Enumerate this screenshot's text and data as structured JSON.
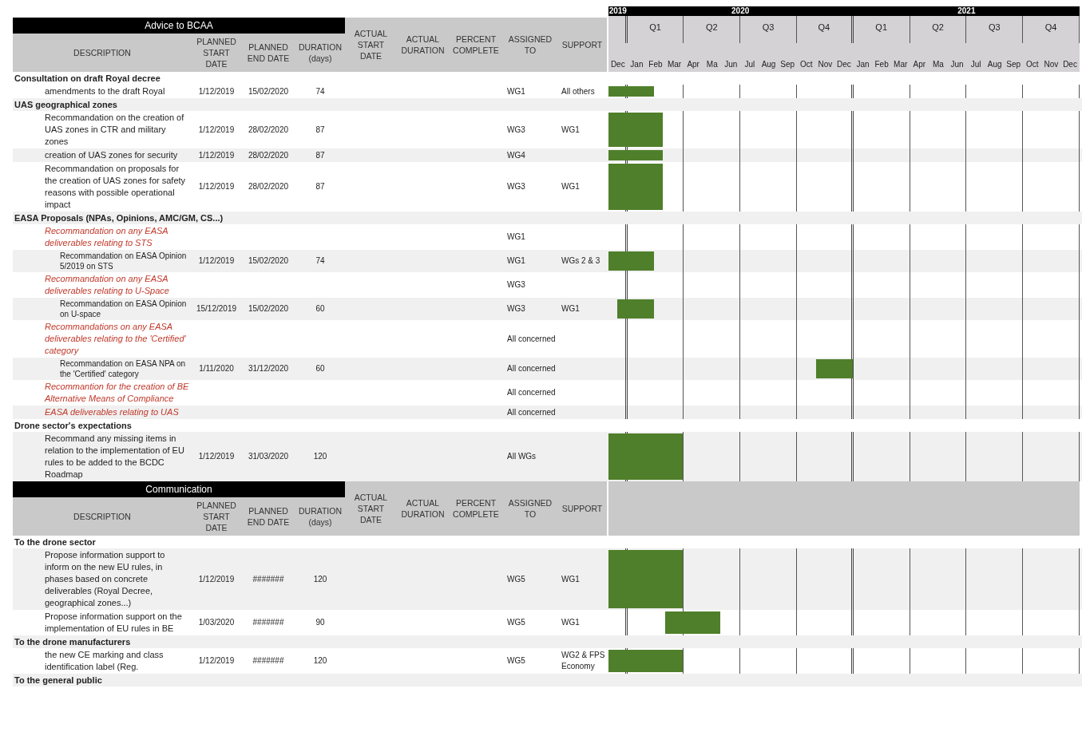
{
  "timeline": {
    "years": [
      "2019",
      "2020",
      "2021"
    ],
    "quarters": [
      "Q1",
      "Q2",
      "Q3",
      "Q4",
      "Q1",
      "Q2",
      "Q3",
      "Q4"
    ],
    "months": [
      "Dec",
      "Jan",
      "Feb",
      "Mar",
      "Apr",
      "Ma",
      "Jun",
      "Jul",
      "Aug",
      "Sep",
      "Oct",
      "Nov",
      "Dec",
      "Jan",
      "Feb",
      "Mar",
      "Apr",
      "Ma",
      "Jun",
      "Jul",
      "Aug",
      "Sep",
      "Oct",
      "Nov",
      "Dec"
    ]
  },
  "blocks": [
    {
      "title": "Advice to BCAA",
      "columns": [
        "DESCRIPTION",
        "PLANNED START DATE",
        "PLANNED END DATE",
        "DURATION (days)",
        "ACTUAL START DATE",
        "ACTUAL DURATION",
        "PERCENT COMPLETE",
        "ASSIGNED TO",
        "SUPPORT"
      ],
      "rows": [
        {
          "kind": "section",
          "description": "Consultation on draft Royal decree",
          "shaded": false
        },
        {
          "kind": "task",
          "description": "amendments to the draft Royal",
          "start": "1/12/2019",
          "end": "15/02/2020",
          "duration": "74",
          "assigned": "WG1",
          "support": "All others",
          "shaded": false
        },
        {
          "kind": "section",
          "description": "UAS geographical zones",
          "shaded": true
        },
        {
          "kind": "task",
          "description": "Recommandation on the creation of UAS zones in CTR and military zones",
          "start": "1/12/2019",
          "end": "28/02/2020",
          "duration": "87",
          "assigned": "WG3",
          "support": "WG1",
          "shaded": false
        },
        {
          "kind": "task",
          "description": "creation of UAS zones for security",
          "start": "1/12/2019",
          "end": "28/02/2020",
          "duration": "87",
          "assigned": "WG4",
          "shaded": true
        },
        {
          "kind": "task",
          "description": "Recommandation on proposals for the creation of UAS zones for safety reasons with possible operational impact",
          "start": "1/12/2019",
          "end": "28/02/2020",
          "duration": "87",
          "assigned": "WG3",
          "support": "WG1",
          "shaded": false
        },
        {
          "kind": "section",
          "description": "EASA Proposals (NPAs, Opinions, AMC/GM, CS...)",
          "shaded": true
        },
        {
          "kind": "deliverable",
          "description": "Recommandation on any EASA deliverables relating to STS",
          "assigned": "WG1",
          "shaded": false
        },
        {
          "kind": "subtask",
          "description": "Recommandation on EASA Opinion 5/2019 on STS",
          "start": "1/12/2019",
          "end": "15/02/2020",
          "duration": "74",
          "assigned": "WG1",
          "support": "WGs 2 & 3",
          "shaded": true
        },
        {
          "kind": "deliverable",
          "description": "Recommandation on any EASA deliverables relating to U-Space",
          "assigned": "WG3",
          "shaded": false
        },
        {
          "kind": "subtask",
          "description": "Recommandation on EASA Opinion on U-space",
          "start": "15/12/2019",
          "end": "15/02/2020",
          "duration": "60",
          "assigned": "WG3",
          "support": "WG1",
          "shaded": true
        },
        {
          "kind": "deliverable",
          "description": "Recommandations on any EASA deliverables relating to the 'Certified' category",
          "assigned": "All concerned",
          "shaded": false
        },
        {
          "kind": "subtask",
          "description": "Recommandation on EASA NPA on the 'Certified' category",
          "start": "1/11/2020",
          "end": "31/12/2020",
          "duration": "60",
          "assigned": "All concerned",
          "shaded": true
        },
        {
          "kind": "deliverable",
          "description": "Recommantion for the creation of BE Alternative Means of Compliance",
          "assigned": "All concerned",
          "shaded": false
        },
        {
          "kind": "deliverable",
          "description": "EASA deliverables relating to UAS",
          "assigned": "All concerned",
          "shaded": true
        },
        {
          "kind": "section",
          "description": "Drone sector's expectations",
          "shaded": false
        },
        {
          "kind": "task",
          "description": "Recommand any missing items in relation to the implementation of EU rules to be added to the BCDC Roadmap",
          "start": "1/12/2019",
          "end": "31/03/2020",
          "duration": "120",
          "assigned": "All WGs",
          "shaded": true
        }
      ]
    },
    {
      "title": "Communication",
      "columns": [
        "DESCRIPTION",
        "PLANNED START DATE",
        "PLANNED END DATE",
        "DURATION (days)",
        "ACTUAL START DATE",
        "ACTUAL DURATION",
        "PERCENT COMPLETE",
        "ASSIGNED TO",
        "SUPPORT"
      ],
      "rows": [
        {
          "kind": "section",
          "description": "To the drone sector",
          "shaded": false
        },
        {
          "kind": "task",
          "description": "Propose information support to inform on the new EU rules, in phases based on concrete deliverables (Royal Decree, geographical zones...)",
          "start": "1/12/2019",
          "end": "#######",
          "duration": "120",
          "assigned": "WG5",
          "support": "WG1",
          "shaded": true
        },
        {
          "kind": "task",
          "description": "Propose information support on the implementation of EU rules in BE",
          "start": "1/03/2020",
          "end": "#######",
          "duration": "90",
          "assigned": "WG5",
          "support": "WG1",
          "shaded": false
        },
        {
          "kind": "section",
          "description": "To the drone manufacturers",
          "shaded": true
        },
        {
          "kind": "task",
          "description": "the new CE marking and class identification label (Reg.",
          "start": "1/12/2019",
          "end": "#######",
          "duration": "120",
          "assigned": "WG5",
          "support": "WG2 & FPS Economy",
          "shaded": false
        },
        {
          "kind": "section",
          "description": "To the general public",
          "shaded": true
        }
      ]
    }
  ]
}
